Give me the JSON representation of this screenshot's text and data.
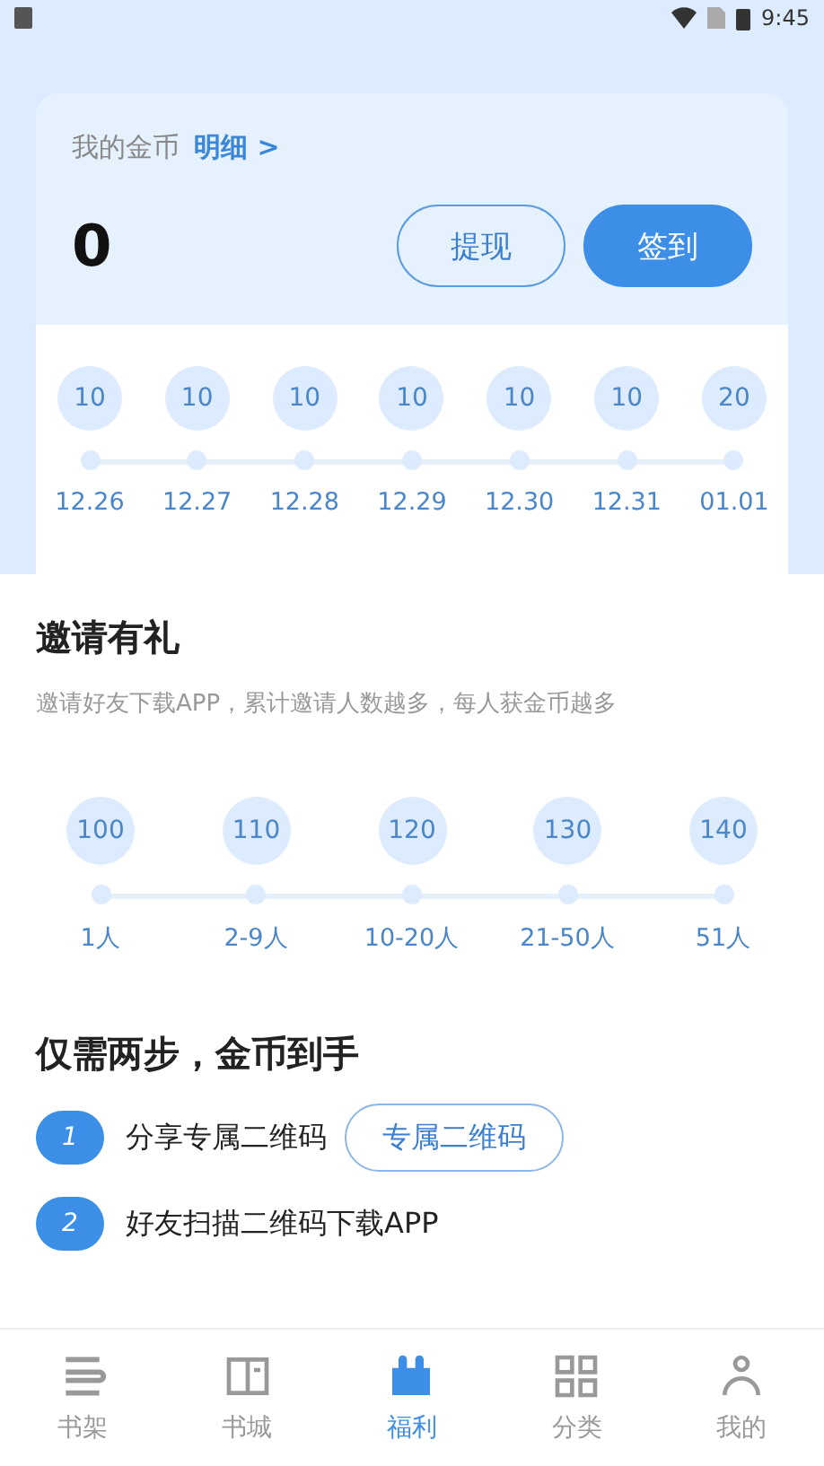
{
  "status_bar": {
    "time": "9:45"
  },
  "coins": {
    "label": "我的金币",
    "detail_link": "明细 >",
    "amount": "0",
    "buttons": [
      {
        "label": "提现",
        "kind": "outline"
      },
      {
        "label": "签到",
        "kind": "filled"
      }
    ]
  },
  "checkin_days": [
    {
      "reward": "10",
      "date": "12.26"
    },
    {
      "reward": "10",
      "date": "12.27"
    },
    {
      "reward": "10",
      "date": "12.28"
    },
    {
      "reward": "10",
      "date": "12.29"
    },
    {
      "reward": "10",
      "date": "12.30"
    },
    {
      "reward": "10",
      "date": "12.31"
    },
    {
      "reward": "20",
      "date": "01.01"
    }
  ],
  "invite": {
    "title": "邀请有礼",
    "subtitle": "邀请好友下载APP，累计邀请人数越多，每人获金币越多",
    "tiers": [
      {
        "reward": "100",
        "people": "1人"
      },
      {
        "reward": "110",
        "people": "2-9人"
      },
      {
        "reward": "120",
        "people": "10-20人"
      },
      {
        "reward": "130",
        "people": "21-50人"
      },
      {
        "reward": "140",
        "people": "51人"
      }
    ]
  },
  "steps": {
    "title": "仅需两步，金币到手",
    "items": [
      {
        "number": "1",
        "text": "分享专属二维码",
        "button": "专属二维码"
      },
      {
        "number": "2",
        "text": "好友扫描二维码下载APP"
      }
    ]
  },
  "tab_bar": [
    {
      "label": "书架",
      "kind": "shelf",
      "selected": false
    },
    {
      "label": "书城",
      "kind": "book",
      "selected": false
    },
    {
      "label": "福利",
      "kind": "gift",
      "selected": true
    },
    {
      "label": "分类",
      "kind": "grid",
      "selected": false
    },
    {
      "label": "我的",
      "kind": "person",
      "selected": false
    }
  ]
}
